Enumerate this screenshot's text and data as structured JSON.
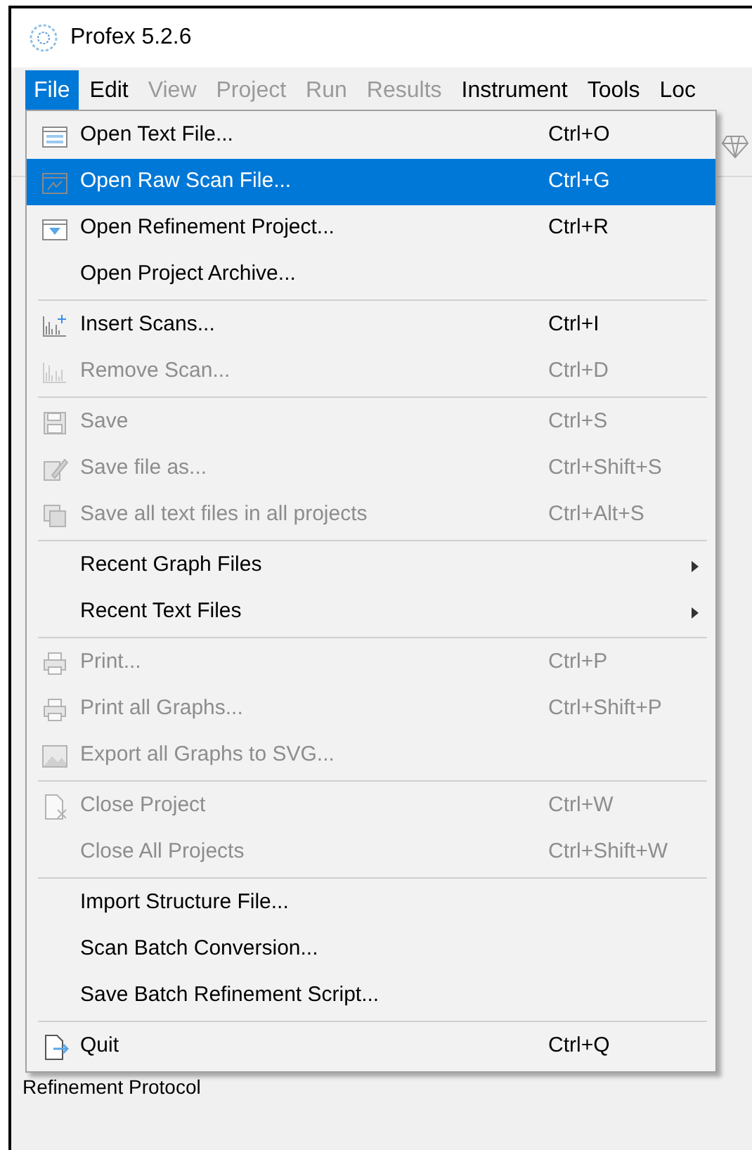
{
  "window": {
    "title": "Profex 5.2.6"
  },
  "menu_bar": [
    {
      "label": "File",
      "selected": true,
      "disabled": false
    },
    {
      "label": "Edit",
      "selected": false,
      "disabled": false
    },
    {
      "label": "View",
      "selected": false,
      "disabled": true
    },
    {
      "label": "Project",
      "selected": false,
      "disabled": true
    },
    {
      "label": "Run",
      "selected": false,
      "disabled": true
    },
    {
      "label": "Results",
      "selected": false,
      "disabled": true
    },
    {
      "label": "Instrument",
      "selected": false,
      "disabled": false
    },
    {
      "label": "Tools",
      "selected": false,
      "disabled": false
    },
    {
      "label": "Loc",
      "selected": false,
      "disabled": false
    }
  ],
  "file_menu": [
    [
      {
        "label": "Open Text File...",
        "shortcut": "Ctrl+O",
        "selected": false,
        "disabled": false,
        "kind": "action"
      },
      {
        "label": "Open Raw Scan File...",
        "shortcut": "Ctrl+G",
        "selected": true,
        "disabled": false,
        "kind": "action"
      },
      {
        "label": "Open Refinement Project...",
        "shortcut": "Ctrl+R",
        "selected": false,
        "disabled": false,
        "kind": "action"
      },
      {
        "label": "Open Project Archive...",
        "selected": false,
        "disabled": false,
        "kind": "action"
      }
    ],
    [
      {
        "label": "Insert Scans...",
        "shortcut": "Ctrl+I",
        "selected": false,
        "disabled": false,
        "kind": "action"
      },
      {
        "label": "Remove Scan...",
        "shortcut": "Ctrl+D",
        "selected": false,
        "disabled": true,
        "kind": "action"
      }
    ],
    [
      {
        "label": "Save",
        "shortcut": "Ctrl+S",
        "selected": false,
        "disabled": true,
        "kind": "action"
      },
      {
        "label": "Save file as...",
        "shortcut": "Ctrl+Shift+S",
        "selected": false,
        "disabled": true,
        "kind": "action"
      },
      {
        "label": "Save all text files in all projects",
        "shortcut": "Ctrl+Alt+S",
        "selected": false,
        "disabled": true,
        "kind": "action"
      }
    ],
    [
      {
        "label": "Recent Graph Files",
        "selected": false,
        "disabled": false,
        "kind": "submenu"
      },
      {
        "label": "Recent Text Files",
        "selected": false,
        "disabled": false,
        "kind": "submenu"
      }
    ],
    [
      {
        "label": "Print...",
        "shortcut": "Ctrl+P",
        "selected": false,
        "disabled": true,
        "kind": "action"
      },
      {
        "label": "Print all Graphs...",
        "shortcut": "Ctrl+Shift+P",
        "selected": false,
        "disabled": true,
        "kind": "action"
      },
      {
        "label": "Export all Graphs to SVG...",
        "selected": false,
        "disabled": true,
        "kind": "action"
      }
    ],
    [
      {
        "label": "Close Project",
        "shortcut": "Ctrl+W",
        "selected": false,
        "disabled": true,
        "kind": "action"
      },
      {
        "label": "Close All Projects",
        "shortcut": "Ctrl+Shift+W",
        "selected": false,
        "disabled": true,
        "kind": "action"
      }
    ],
    [
      {
        "label": "Import Structure File...",
        "selected": false,
        "disabled": false,
        "kind": "action"
      },
      {
        "label": "Scan Batch Conversion...",
        "selected": false,
        "disabled": false,
        "kind": "action"
      },
      {
        "label": "Save Batch Refinement Script...",
        "selected": false,
        "disabled": false,
        "kind": "action"
      }
    ],
    [
      {
        "label": "Quit",
        "shortcut": "Ctrl+Q",
        "selected": false,
        "disabled": false,
        "kind": "action"
      }
    ]
  ],
  "panel_label": "Refinement Protocol"
}
